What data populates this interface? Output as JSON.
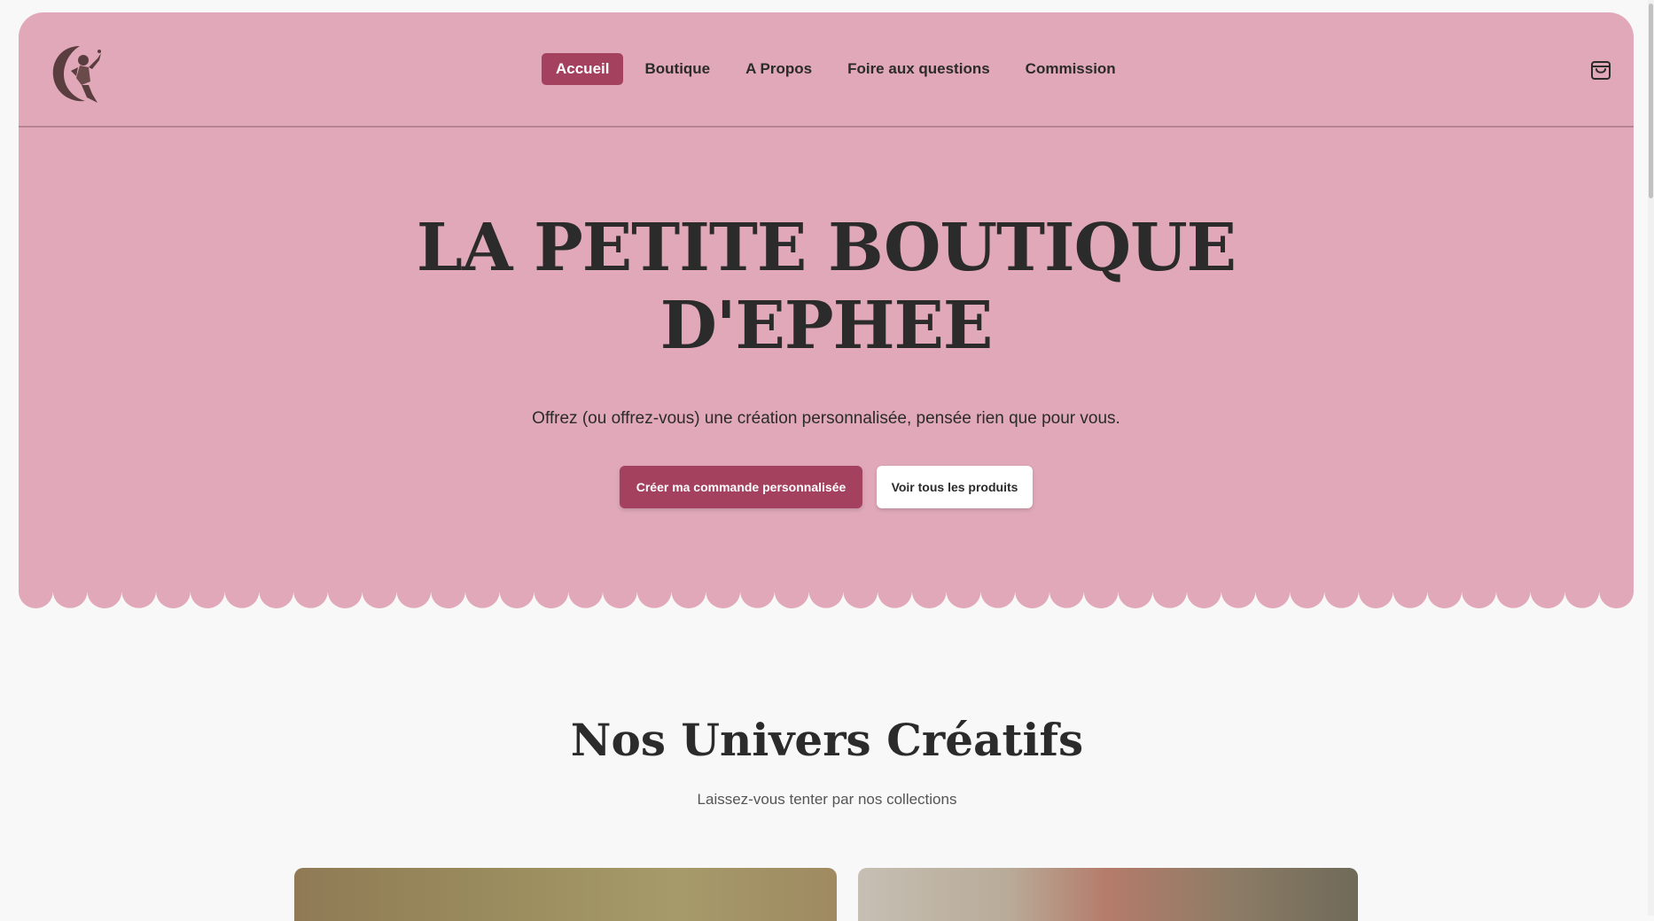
{
  "nav": {
    "items": [
      {
        "label": "Accueil",
        "active": true
      },
      {
        "label": "Boutique",
        "active": false
      },
      {
        "label": "A Propos",
        "active": false
      },
      {
        "label": "Foire aux questions",
        "active": false
      },
      {
        "label": "Commission",
        "active": false
      }
    ],
    "logo_icon": "moon-fairy-logo",
    "cart_icon": "shopping-bag-icon"
  },
  "hero": {
    "title_line1": "LA PETITE BOUTIQUE",
    "title_line2": "D'EPHEE",
    "tagline": "Offrez (ou offrez-vous) une création personnalisée, pensée rien que pour vous.",
    "primary_cta": "Créer ma commande personnalisée",
    "secondary_cta": "Voir tous les produits"
  },
  "section": {
    "title": "Nos Univers Créatifs",
    "subtitle": "Laissez-vous tenter par nos collections"
  },
  "colors": {
    "hero_bg": "#e0a8b9",
    "accent": "#a4415f",
    "page_bg": "#f8f8f8",
    "text": "#2b2b2b"
  }
}
